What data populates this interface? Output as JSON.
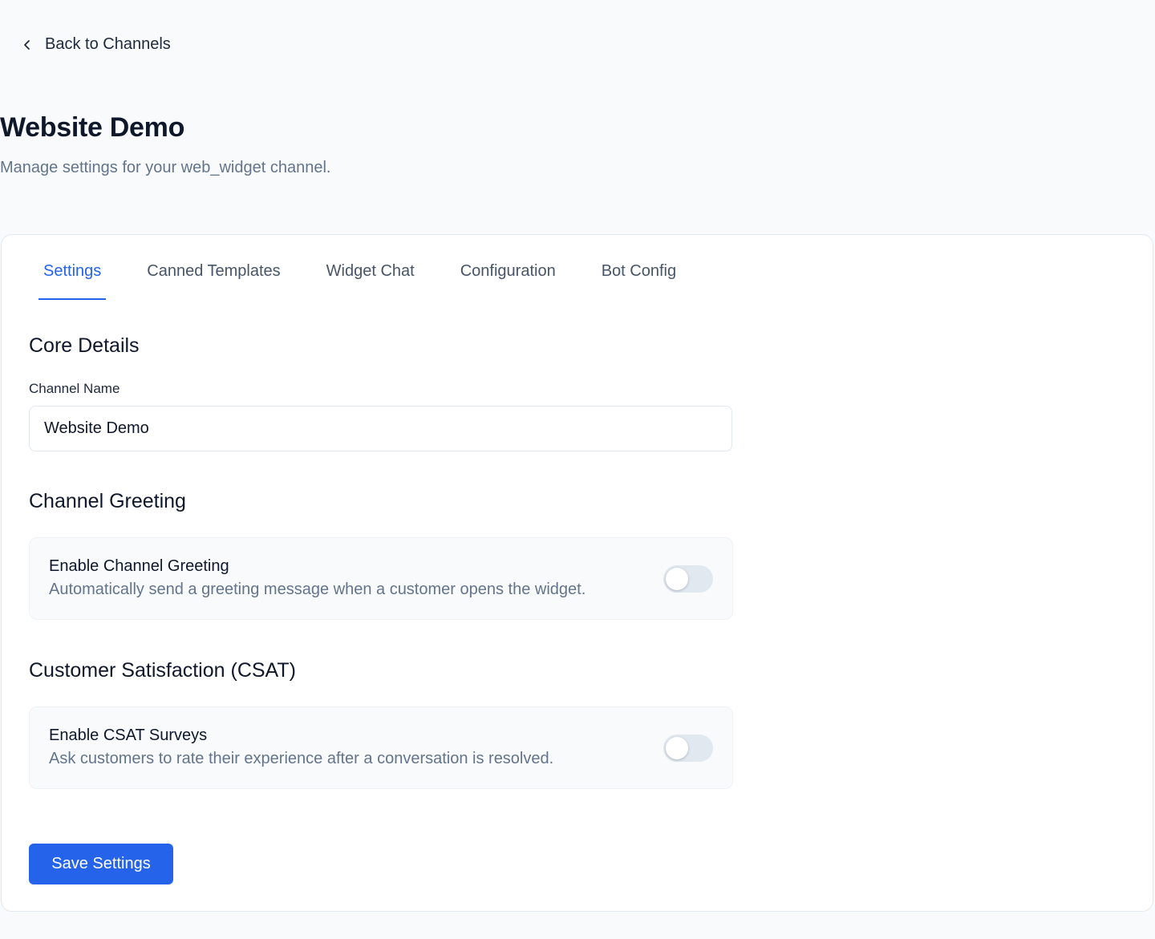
{
  "back": {
    "label": "Back to Channels",
    "icon": "chevron-left-icon"
  },
  "header": {
    "title": "Website Demo",
    "subtitle": "Manage settings for your web_widget channel."
  },
  "tabs": [
    {
      "label": "Settings",
      "active": true
    },
    {
      "label": "Canned Templates",
      "active": false
    },
    {
      "label": "Widget Chat",
      "active": false
    },
    {
      "label": "Configuration",
      "active": false
    },
    {
      "label": "Bot Config",
      "active": false
    }
  ],
  "core_details": {
    "heading": "Core Details",
    "channel_name_label": "Channel Name",
    "channel_name_value": "Website Demo"
  },
  "greeting": {
    "heading": "Channel Greeting",
    "toggle_title": "Enable Channel Greeting",
    "toggle_desc": "Automatically send a greeting message when a customer opens the widget.",
    "enabled": false
  },
  "csat": {
    "heading": "Customer Satisfaction (CSAT)",
    "toggle_title": "Enable CSAT Surveys",
    "toggle_desc": "Ask customers to rate their experience after a conversation is resolved.",
    "enabled": false
  },
  "actions": {
    "save_label": "Save Settings"
  },
  "colors": {
    "accent": "#2563eb",
    "page_bg": "#f8fafc",
    "muted_text": "#64748b"
  }
}
